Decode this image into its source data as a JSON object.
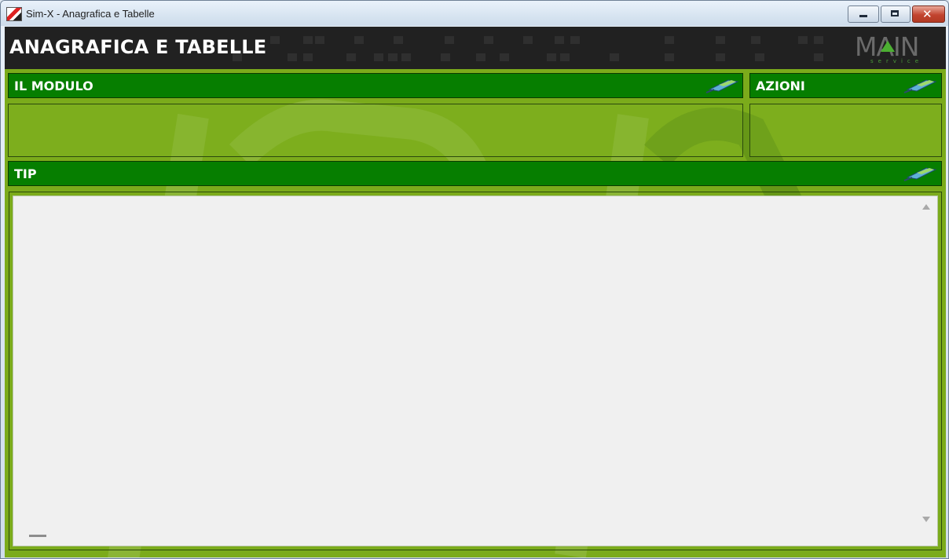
{
  "window": {
    "title": "Sim-X - Anagrafica e Tabelle",
    "controls": [
      "minimize",
      "maximize",
      "close"
    ]
  },
  "header": {
    "title": "ANAGRAFICA E TABELLE",
    "logo": {
      "word": "MAIN",
      "subtitle": "service"
    }
  },
  "panels": {
    "module": {
      "label": "IL MODULO",
      "icon": "pin-icon"
    },
    "actions": {
      "label": "AZIONI",
      "icon": "pin-icon"
    },
    "tip": {
      "label": "TIP",
      "icon": "pin-icon"
    }
  },
  "colors": {
    "panel_header": "#067e00",
    "background_green": "#7bab1b",
    "header_dark": "#1c1c1c",
    "tip_area": "#f0f0f0"
  }
}
